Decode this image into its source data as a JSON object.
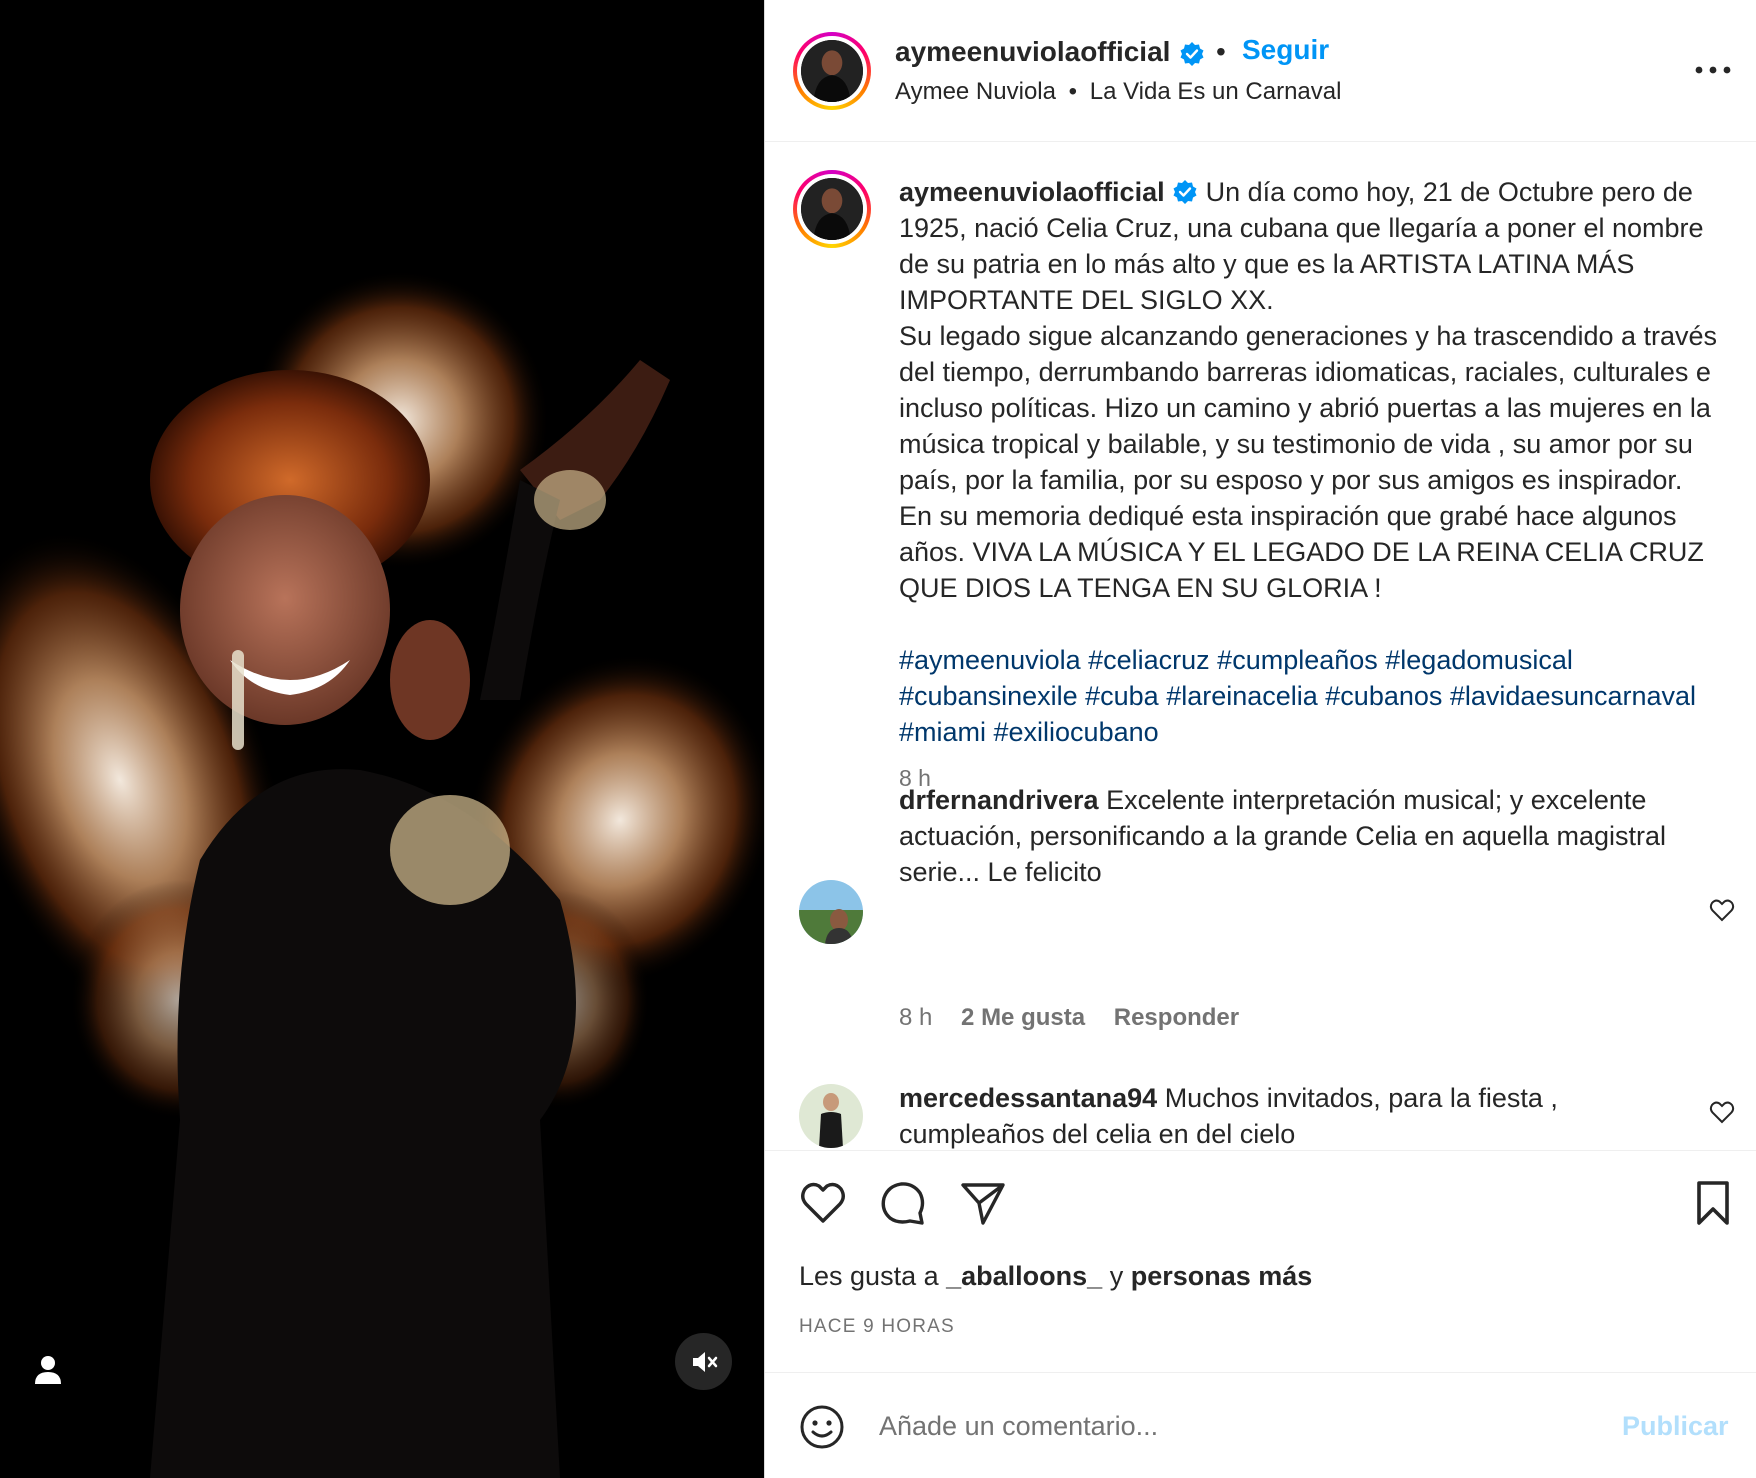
{
  "post": {
    "username": "aymeenuviolaofficial",
    "follow_label": "Seguir",
    "separator": "•",
    "audio_artist": "Aymee Nuviola",
    "audio_dot": "•",
    "audio_title": "La Vida Es un Carnaval"
  },
  "caption": {
    "username": "aymeenuviolaofficial",
    "lines": [
      "Un día como hoy, 21 de Octubre pero de 1925, nació Celia Cruz, una cubana que llegaría a poner el nombre de su patria en lo más alto y que es la ARTISTA LATINA MÁS IMPORTANTE DEL SIGLO XX.",
      "Su legado sigue alcanzando generaciones y ha trascendido a través del tiempo, derrumbando barreras idiomaticas, raciales, culturales e incluso políticas. Hizo un camino y abrió puertas a las mujeres en la música tropical y bailable, y su testimonio de vida , su amor por su país, por la familia, por su esposo y por sus amigos es inspirador.",
      "En su memoria dediqué esta inspiración que grabé hace algunos años. VIVA LA MÚSICA Y EL LEGADO DE LA REINA CELIA CRUZ QUE DIOS LA TENGA EN SU GLORIA !"
    ],
    "hashtags": "#aymeenuviola #celiacruz #cumpleaños #legadomusical #cubansinexile #cuba #lareinacelia #cubanos #lavidaesuncarnaval #miami #exiliocubano",
    "time": "8 h"
  },
  "comments": [
    {
      "username": "drfernandrivera",
      "text": "Excelente interpretación musical; y excelente actuación, personificando a la grande Celia en aquella magistral serie... Le felicito",
      "time": "8 h",
      "likes": "2 Me gusta",
      "reply": "Responder"
    },
    {
      "username": "mercedessantana94",
      "text": "Muchos invitados, para la fiesta , cumpleaños del celia en del cielo"
    }
  ],
  "likes": {
    "prefix": "Les gusta a",
    "user": "_aballoons_",
    "conj": "y",
    "others": "personas más"
  },
  "posted_ago": "HACE 9 HORAS",
  "composer": {
    "placeholder": "Añade un comentario...",
    "publish_label": "Publicar"
  },
  "colors": {
    "link_blue": "#0095f6",
    "hashtag_blue": "#00376b",
    "verified_blue": "#0095f6",
    "muted_gray": "#737373",
    "publish_disabled": "#b2dffc"
  },
  "icons": {
    "like": "heart-icon",
    "comment": "comment-bubble-icon",
    "share": "paper-plane-icon",
    "save": "bookmark-icon",
    "more": "ellipsis-icon",
    "emoji": "smiley-icon",
    "mute": "speaker-muted-icon",
    "tag": "user-tag-icon"
  }
}
